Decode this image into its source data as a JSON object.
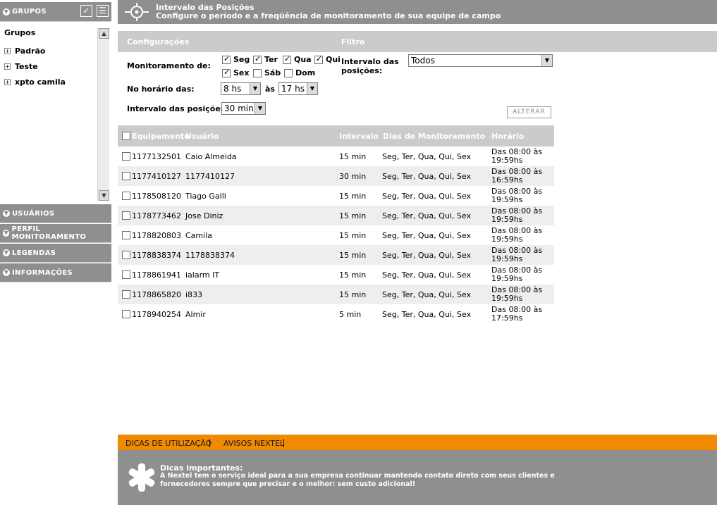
{
  "sidebar": {
    "grupos_label": "GRUPOS",
    "tree": {
      "title": "Grupos",
      "items": [
        {
          "label": "Padrão"
        },
        {
          "label": "Teste"
        },
        {
          "label": "xpto camila"
        }
      ]
    },
    "usuarios_label": "USUÁRIOS",
    "perfil_label": "PERFIL MONITORAMENTO",
    "legendas_label": "LEGENDAS",
    "informacoes_label": "INFORMAÇÕES"
  },
  "header": {
    "title": "Intervalo das Posições",
    "subtitle": "Configure o período e a freqüência de monitoramento de sua equipe de campo"
  },
  "config": {
    "section_configuracoes": "Configurações",
    "section_filtro": "Filtro",
    "monitoramento_label": "Monitoramento de:",
    "days": [
      {
        "label": "Seg",
        "checked": true
      },
      {
        "label": "Ter",
        "checked": true
      },
      {
        "label": "Qua",
        "checked": true
      },
      {
        "label": "Qui",
        "checked": true
      },
      {
        "label": "Sex",
        "checked": true
      },
      {
        "label": "Sáb",
        "checked": false
      },
      {
        "label": "Dom",
        "checked": false
      }
    ],
    "horario_label": "No horário das:",
    "horario_inicio": "8 hs",
    "horario_sep": "às",
    "horario_fim": "17 hs",
    "intervalo_label": "Intervalo das posições:",
    "intervalo_value": "30 min",
    "filtro_label_1": "Intervalo das",
    "filtro_label_2": "posições:",
    "filtro_value": "Todos",
    "alterar_button": "ALTERAR"
  },
  "table": {
    "headers": {
      "equipamento": "Equipamento",
      "usuario": "Usuário",
      "intervalo": "Intervalo",
      "dias": "Dias de Monitoramento",
      "horario": "Horário"
    },
    "rows": [
      {
        "equip": "1177132501",
        "user": "Caio Almeida",
        "intervalo": "15 min",
        "dias": "Seg, Ter, Qua, Qui, Sex",
        "horario_1": "Das 08:00 às",
        "horario_2": "19:59hs"
      },
      {
        "equip": "1177410127",
        "user": "1177410127",
        "intervalo": "30 min",
        "dias": "Seg, Ter, Qua, Qui, Sex",
        "horario_1": "Das 08:00 às",
        "horario_2": "16:59hs"
      },
      {
        "equip": "1178508120",
        "user": "Tiago Galli",
        "intervalo": "15 min",
        "dias": "Seg, Ter, Qua, Qui, Sex",
        "horario_1": "Das 08:00 às",
        "horario_2": "19:59hs"
      },
      {
        "equip": "1178773462",
        "user": "Jose Diniz",
        "intervalo": "15 min",
        "dias": "Seg, Ter, Qua, Qui, Sex",
        "horario_1": "Das 08:00 às",
        "horario_2": "19:59hs"
      },
      {
        "equip": "1178820803",
        "user": "Camila",
        "intervalo": "15 min",
        "dias": "Seg, Ter, Qua, Qui, Sex",
        "horario_1": "Das 08:00 às",
        "horario_2": "19:59hs"
      },
      {
        "equip": "1178838374",
        "user": "1178838374",
        "intervalo": "15 min",
        "dias": "Seg, Ter, Qua, Qui, Sex",
        "horario_1": "Das 08:00 às",
        "horario_2": "19:59hs"
      },
      {
        "equip": "1178861941",
        "user": "ialarm IT",
        "intervalo": "15 min",
        "dias": "Seg, Ter, Qua, Qui, Sex",
        "horario_1": "Das 08:00 às",
        "horario_2": "19:59hs"
      },
      {
        "equip": "1178865820",
        "user": "i833",
        "intervalo": "15 min",
        "dias": "Seg, Ter, Qua, Qui, Sex",
        "horario_1": "Das 08:00 às",
        "horario_2": "19:59hs"
      },
      {
        "equip": "1178940254",
        "user": "Almir",
        "intervalo": "5 min",
        "dias": "Seg, Ter, Qua, Qui, Sex",
        "horario_1": "Das 08:00 às",
        "horario_2": "17:59hs"
      }
    ]
  },
  "footer": {
    "tab_dicas": "DICAS DE UTILIZAÇÃO",
    "tab_avisos": "AVISOS NEXTEL",
    "tips_title": "Dicas importantes:",
    "tips_text": "A Nextel tem o serviço ideal para a sua empresa continuar mantendo contato direto com seus clientes e fornecedores sempre que precisar e o melhor: sem custo adicional!"
  },
  "colors": {
    "panel_gray": "#8f8f8f",
    "light_gray": "#cbcbcb",
    "row_alt": "#eeeeee",
    "accent_orange": "#f08a00"
  },
  "icons": [
    "chevron-down-icon",
    "checkbox-select-all-icon",
    "export-list-icon",
    "location-target-icon",
    "tree-expand-icon",
    "scroll-up-icon",
    "scroll-down-icon",
    "dropdown-arrow-icon",
    "nextel-star-icon"
  ]
}
